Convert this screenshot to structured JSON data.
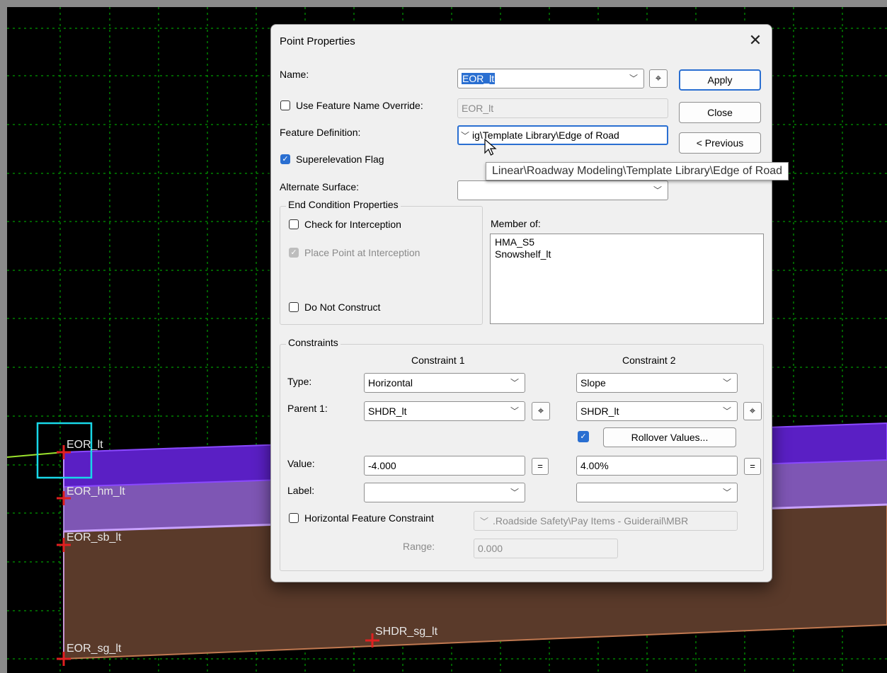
{
  "canvas": {
    "point_labels": {
      "eor_lt": "EOR_lt",
      "eor_hm_lt": "EOR_hm_lt",
      "eor_sb_lt": "EOR_sb_lt",
      "eor_sg_lt": "EOR_sg_lt",
      "shdr_sg_lt": "SHDR_sg_lt"
    },
    "colors": {
      "background": "#000000",
      "grid": "#00c000",
      "hma_layer": "#5a1fc4",
      "base_layer": "#7e56b4",
      "subgrade_layer": "#5a3a2a",
      "selection": "#18d8e8",
      "point_marker": "#e02020"
    }
  },
  "dialog": {
    "title": "Point Properties",
    "close_icon": "close-icon",
    "name_label": "Name:",
    "name_value": "EOR_lt",
    "use_override_label": "Use Feature Name Override:",
    "use_override_checked": false,
    "override_value": "EOR_lt",
    "feature_definition_label": "Feature Definition:",
    "feature_definition_value": "ig\\Template Library\\Edge of Road",
    "superelevation_label": "Superelevation Flag",
    "superelevation_checked": true,
    "alternate_surface_label": "Alternate Surface:",
    "alternate_surface_value": "",
    "buttons": {
      "apply": "Apply",
      "close": "Close",
      "previous": "< Previous"
    },
    "tooltip": "Linear\\Roadway Modeling\\Template Library\\Edge of Road",
    "end_condition": {
      "title": "End Condition Properties",
      "check_interception": "Check for Interception",
      "place_point": "Place Point at Interception",
      "do_not_construct": "Do Not Construct"
    },
    "member_of": {
      "label": "Member of:",
      "items": [
        "HMA_S5",
        "Snowshelf_lt"
      ]
    },
    "constraints": {
      "title": "Constraints",
      "col1_header": "Constraint 1",
      "col2_header": "Constraint 2",
      "type_label": "Type:",
      "parent_label": "Parent 1:",
      "value_label": "Value:",
      "label_label": "Label:",
      "c1_type": "Horizontal",
      "c2_type": "Slope",
      "c1_parent": "SHDR_lt",
      "c2_parent": "SHDR_lt",
      "rollover_checked": true,
      "rollover_button": "Rollover Values...",
      "c1_value": "-4.000",
      "c2_value": "4.00%",
      "c1_label": "",
      "c2_label": "",
      "equals": "=",
      "horizontal_feature_label": "Horizontal Feature Constraint",
      "horizontal_feature_value": ".Roadside Safety\\Pay Items - Guiderail\\MBR",
      "range_label": "Range:",
      "range_value": "0.000"
    }
  }
}
